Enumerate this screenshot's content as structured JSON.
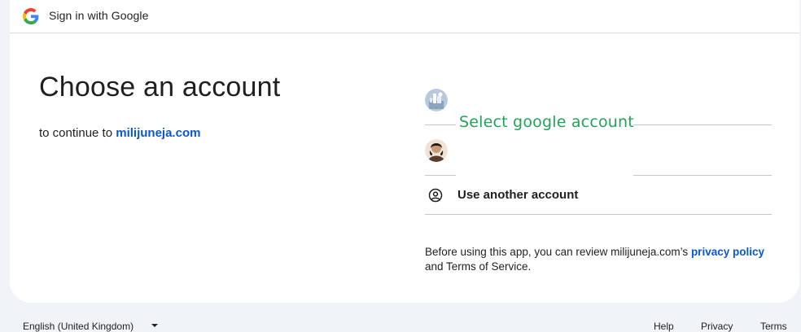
{
  "header": {
    "title": "Sign in with Google",
    "logo_icon": "google-g-logo"
  },
  "main": {
    "heading": "Choose an account",
    "subtitle_prefix": "to continue to",
    "domain": "milijuneja.com"
  },
  "accounts": [
    {
      "avatar_icon": "account-avatar-photo"
    },
    {
      "avatar_icon": "account-avatar-photo"
    }
  ],
  "annotation": {
    "text": "Select google account",
    "color": "#22a35a"
  },
  "use_another": {
    "label": "Use another account",
    "icon": "account-circle-icon"
  },
  "policy": {
    "prefix": "Before using this app, you can review milijuneja.com’s",
    "privacy_link": "privacy policy",
    "middle": "and Terms of Service."
  },
  "footer": {
    "language": "English (United Kingdom)",
    "links": [
      "Help",
      "Privacy",
      "Terms"
    ]
  },
  "colors": {
    "link": "#0b57d0",
    "page_bg": "#f0f3f8",
    "annotation": "#22a35a"
  }
}
